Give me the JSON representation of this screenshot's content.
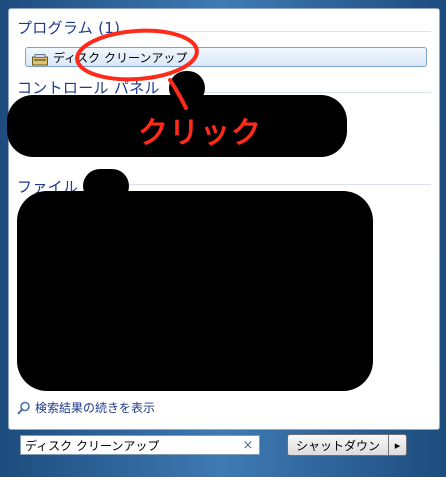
{
  "groups": {
    "programs": {
      "header": "プログラム (1)"
    },
    "control_panel": {
      "header": "コントロール パネル"
    },
    "files": {
      "header": "ファイル"
    }
  },
  "result": {
    "label": "ディスク クリーンアップ",
    "icon": "disk-cleanup-icon"
  },
  "more_results": {
    "label": "検索結果の続きを表示",
    "icon": "search-icon"
  },
  "search": {
    "value": "ディスク クリーンアップ",
    "clear_symbol": "×"
  },
  "shutdown": {
    "label": "シャットダウン",
    "arrow": "▸"
  },
  "annotation": {
    "text": "クリック",
    "color": "#ff2a1a"
  }
}
